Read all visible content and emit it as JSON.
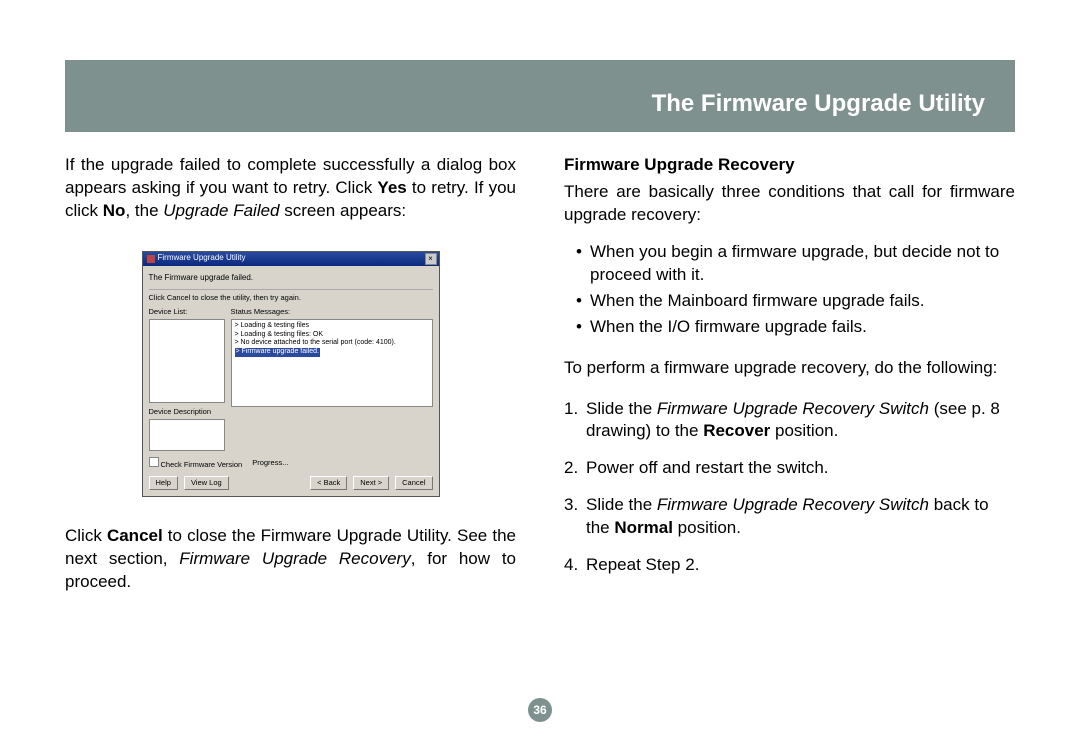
{
  "header": {
    "title": "The Firmware Upgrade Utility"
  },
  "left": {
    "p1a": "If the upgrade failed to complete successfully a dialog box appears asking if you want to retry. Click ",
    "p1b": "Yes",
    "p1c": " to retry. If you click ",
    "p1d": "No",
    "p1e": ", the ",
    "p1f": "Upgrade Failed",
    "p1g": " screen appears:",
    "p2a": "Click ",
    "p2b": "Cancel",
    "p2c": " to close the Firmware Upgrade Utility. See the next section, ",
    "p2d": "Firmware Upgrade Recovery",
    "p2e": ", for how to proceed."
  },
  "right": {
    "section_title": "Firmware Upgrade Recovery",
    "intro": "There are basically three conditions that call for firmware upgrade recovery:",
    "bullets": [
      "When you begin a firmware upgrade, but decide not to proceed with it.",
      "When the Mainboard firmware upgrade fails.",
      "When the I/O firmware upgrade fails."
    ],
    "lead": "To perform a firmware upgrade recovery, do the following:",
    "steps": [
      {
        "num": "1.",
        "a": "Slide the ",
        "b": "Firmware Upgrade Recovery Switch",
        "c": " (see p. 8 drawing) to the ",
        "d": "Recover",
        "e": " position."
      },
      {
        "num": "2.",
        "text": "Power off and restart the switch."
      },
      {
        "num": "3.",
        "a": "Slide the ",
        "b": "Firmware Upgrade Recovery Switch",
        "c": " back to the ",
        "d": "Normal",
        "e": " position."
      },
      {
        "num": "4.",
        "text": "Repeat Step 2."
      }
    ]
  },
  "page_number": "36",
  "fw": {
    "title": "Firmware Upgrade Utility",
    "heading": "The Firmware upgrade failed.",
    "sub": "Click Cancel to close the utility, then try again.",
    "device_list_label": "Device List:",
    "status_label": "Status Messages:",
    "status_lines": [
      "> Loading & testing files",
      "> Loading & testing files: OK",
      "> No device attached to the serial port (code: 4100)."
    ],
    "status_selected": "> Firmware upgrade failed.",
    "desc_label": "Device Description",
    "check_label": "Check Firmware Version",
    "progress_label": "Progress...",
    "btn_help": "Help",
    "btn_viewlog": "View Log",
    "btn_back": "< Back",
    "btn_next": "Next >",
    "btn_cancel": "Cancel"
  }
}
